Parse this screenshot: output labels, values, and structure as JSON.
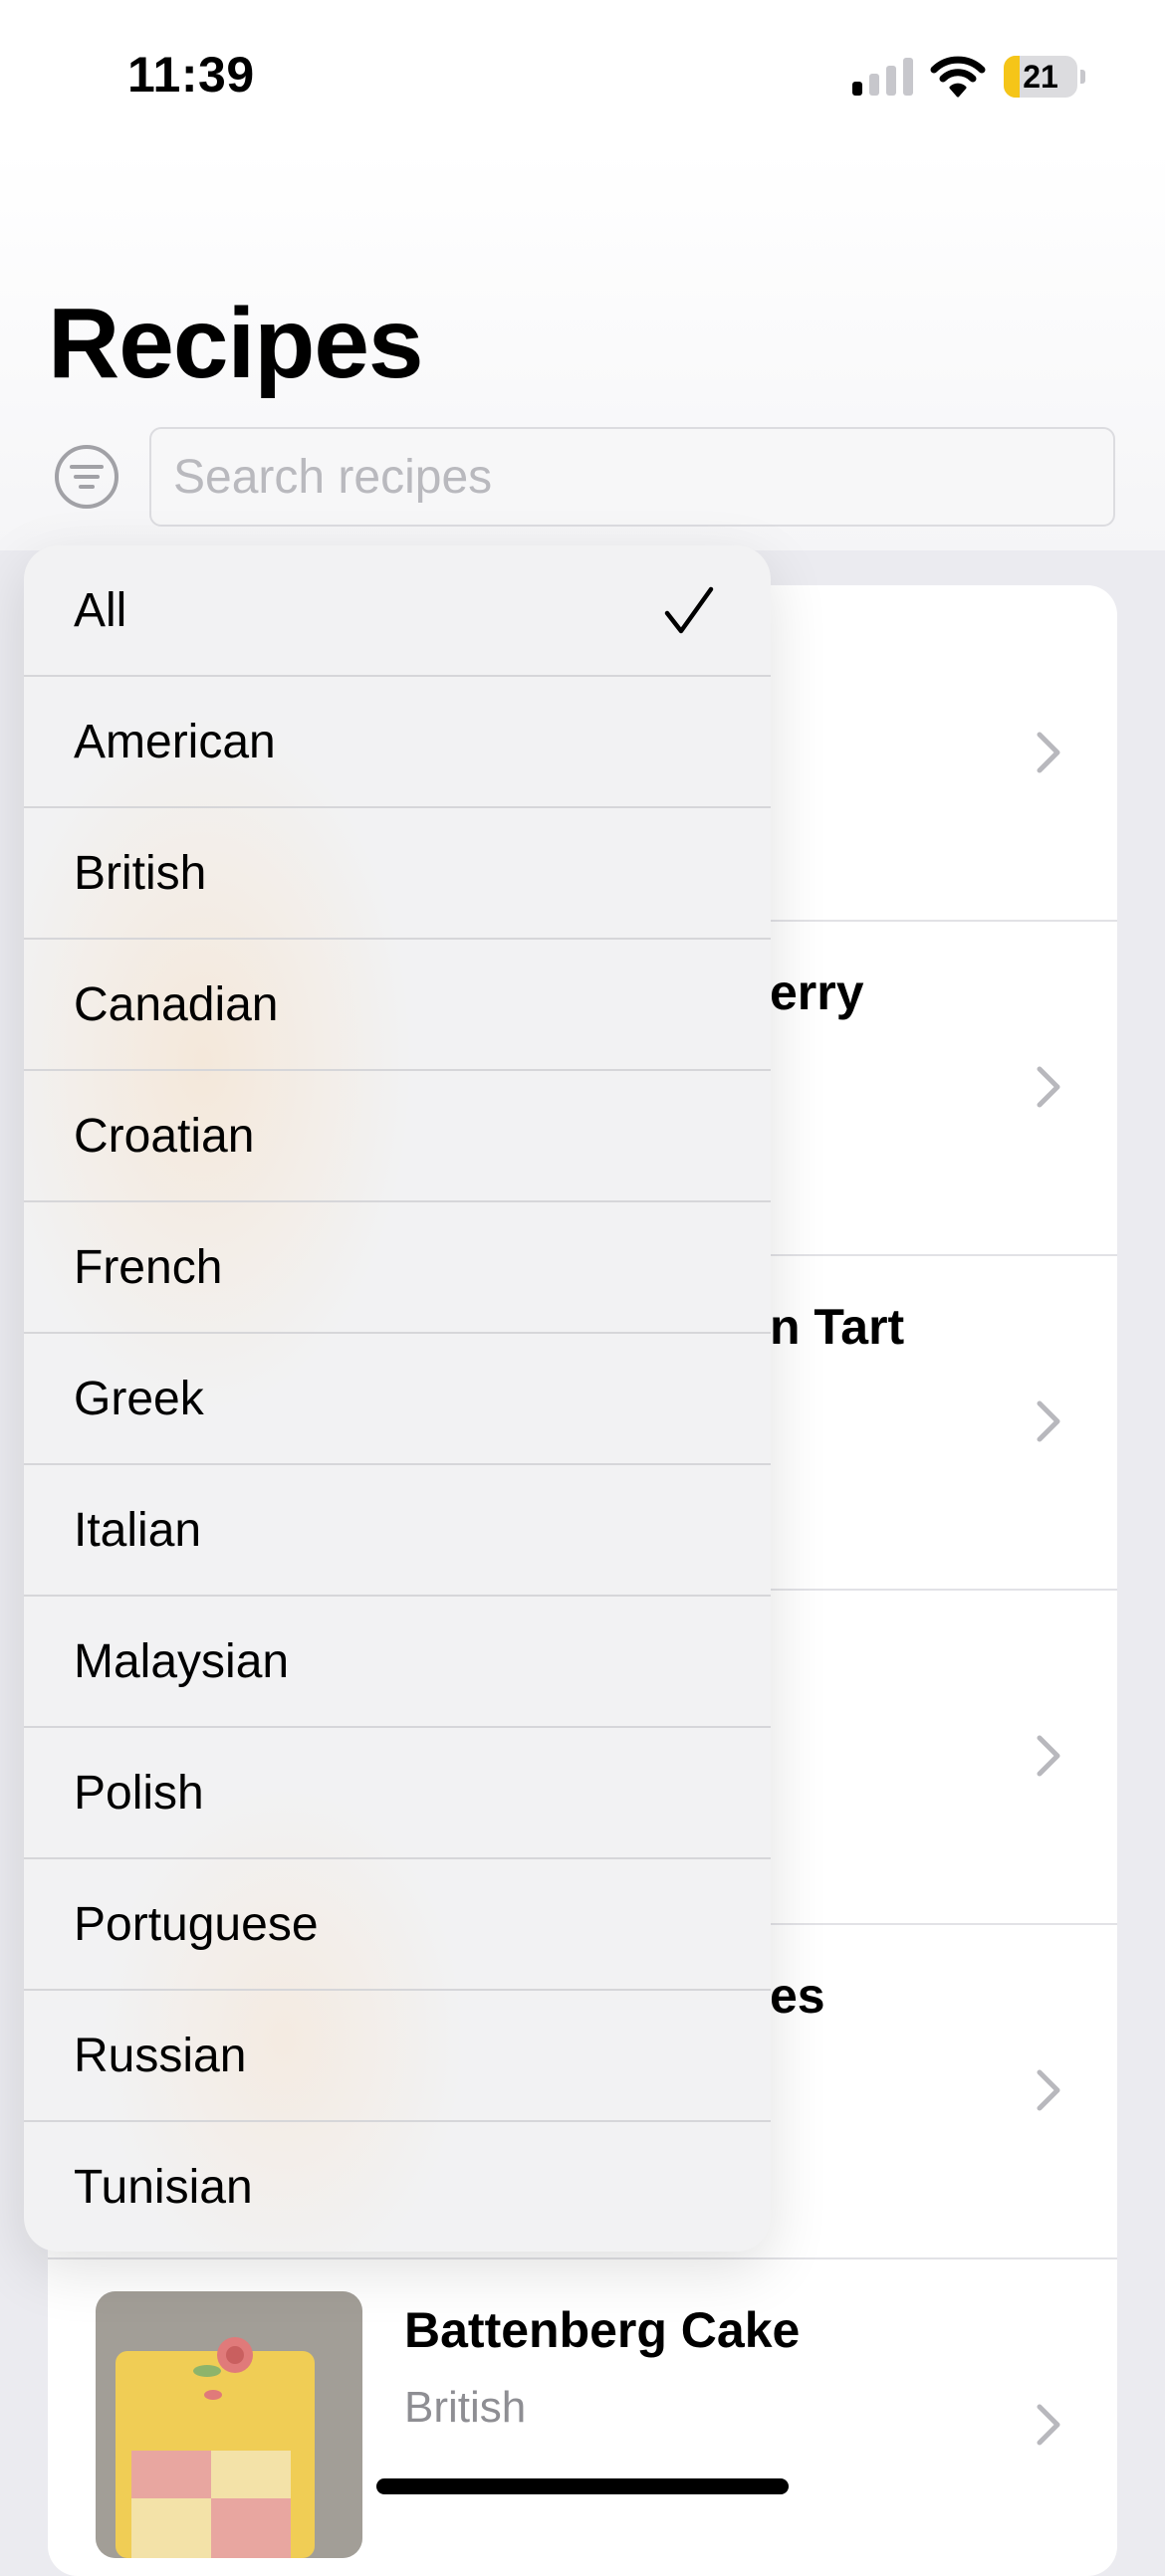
{
  "status_bar": {
    "time": "11:39",
    "battery_level": "21",
    "battery_fraction": 0.21,
    "signal_bars_active": 1
  },
  "header": {
    "title": "Recipes"
  },
  "search": {
    "placeholder": "Search recipes",
    "value": ""
  },
  "filter_menu": {
    "items": [
      {
        "label": "All",
        "selected": true
      },
      {
        "label": "American",
        "selected": false
      },
      {
        "label": "British",
        "selected": false
      },
      {
        "label": "Canadian",
        "selected": false
      },
      {
        "label": "Croatian",
        "selected": false
      },
      {
        "label": "French",
        "selected": false
      },
      {
        "label": "Greek",
        "selected": false
      },
      {
        "label": "Italian",
        "selected": false
      },
      {
        "label": "Malaysian",
        "selected": false
      },
      {
        "label": "Polish",
        "selected": false
      },
      {
        "label": "Portuguese",
        "selected": false
      },
      {
        "label": "Russian",
        "selected": false
      },
      {
        "label": "Tunisian",
        "selected": false
      }
    ]
  },
  "recipes": {
    "visible_fragments": [
      "erry",
      "n Tart",
      "es"
    ],
    "battenberg": {
      "name": "Battenberg Cake",
      "cuisine": "British"
    }
  },
  "colors": {
    "accent_battery": "#f5c518",
    "secondary_text": "#8e8e93"
  },
  "icons": {
    "filter": "line-3-horizontal-decrease-circle",
    "check": "checkmark",
    "chevron": "chevron-right"
  }
}
